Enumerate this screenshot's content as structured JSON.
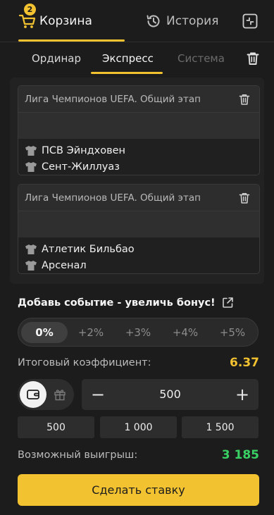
{
  "tabs": {
    "cart_label": "Корзина",
    "cart_badge": "2",
    "history_label": "История"
  },
  "subtabs": {
    "single": "Ординар",
    "express": "Экспресс",
    "system": "Система"
  },
  "events": [
    {
      "league": "Лига Чемпионов UEFA. Общий этап",
      "team1": "ПСВ Эйндховен",
      "team2": "Сент-Жиллуаз"
    },
    {
      "league": "Лига Чемпионов UEFA. Общий этап",
      "team1": "Атлетик Бильбао",
      "team2": "Арсенал"
    }
  ],
  "bonus": {
    "title": "Добавь событие - увеличь бонус!",
    "options": [
      "0%",
      "+2%",
      "+3%",
      "+4%",
      "+5%"
    ],
    "selected": "0%"
  },
  "coefficient": {
    "label": "Итоговый коэффициент:",
    "value": "6.37"
  },
  "stake": {
    "value": "500",
    "minus": "−",
    "plus": "+",
    "quick": [
      "500",
      "1 000",
      "1 500"
    ]
  },
  "payout": {
    "label": "Возможный выигрыш:",
    "value": "3 185"
  },
  "bet_button": "Сделать ставку",
  "colors": {
    "accent": "#f2c230",
    "win": "#3ad164",
    "background": "#1c1c1c"
  }
}
